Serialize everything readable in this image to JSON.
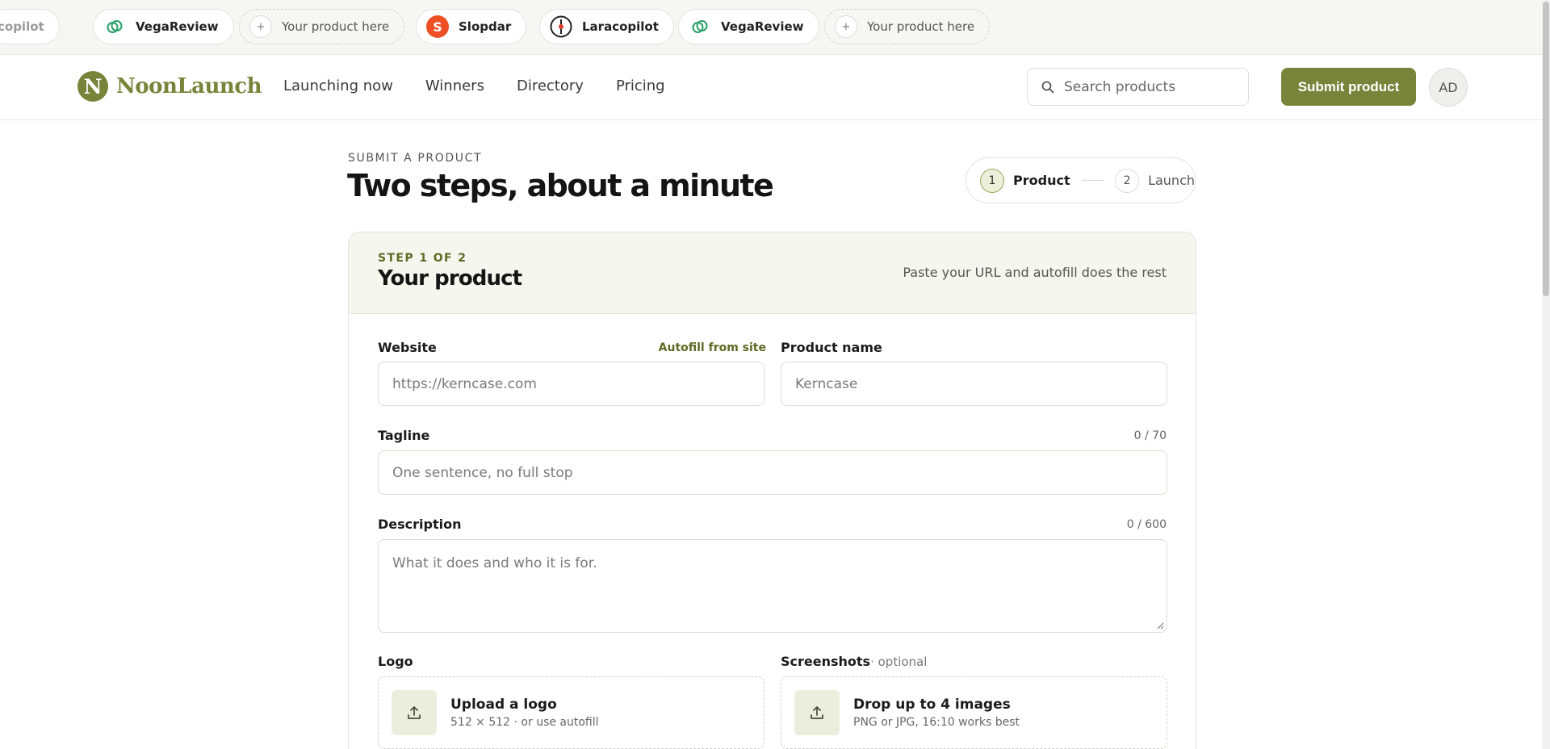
{
  "ticker": {
    "items": [
      {
        "label": "copilot",
        "icon": "laracopilot-icon",
        "dashed": false
      },
      {
        "label": "VegaReview",
        "icon": "vegareview-icon",
        "dashed": false
      },
      {
        "label": "Your product here",
        "icon": "plus-icon",
        "dashed": true
      },
      {
        "label": "Slopdar",
        "icon": "slopdar-icon",
        "dashed": false,
        "glyph": "S"
      },
      {
        "label": "Laracopilot",
        "icon": "laracopilot-icon",
        "dashed": false
      },
      {
        "label": "VegaReview",
        "icon": "vegareview-icon",
        "dashed": false
      },
      {
        "label": "Your product here",
        "icon": "plus-icon",
        "dashed": true
      }
    ],
    "plus_glyph": "+"
  },
  "header": {
    "logo_mark": "N",
    "logo_text": "NoonLaunch",
    "nav": [
      "Launching now",
      "Winners",
      "Directory",
      "Pricing"
    ],
    "search_placeholder": "Search products",
    "submit_label": "Submit product",
    "avatar_initials": "AD"
  },
  "page": {
    "eyebrow": "SUBMIT A PRODUCT",
    "title": "Two steps, about a minute",
    "steps": [
      {
        "number": "1",
        "label": "Product",
        "active": true
      },
      {
        "number": "2",
        "label": "Launch",
        "active": false
      }
    ]
  },
  "card": {
    "step_label": "STEP 1 OF 2",
    "title": "Your product",
    "hint": "Paste your URL and autofill does the rest",
    "website": {
      "label": "Website",
      "action": "Autofill from site",
      "placeholder": "https://kerncase.com"
    },
    "product_name": {
      "label": "Product name",
      "placeholder": "Kerncase"
    },
    "tagline": {
      "label": "Tagline",
      "counter": "0 / 70",
      "placeholder": "One sentence, no full stop"
    },
    "description": {
      "label": "Description",
      "counter": "0 / 600",
      "placeholder": "What it does and who it is for."
    },
    "logo": {
      "label": "Logo",
      "title": "Upload a logo",
      "sub": "512 × 512 · or use autofill"
    },
    "screenshots": {
      "label": "Screenshots",
      "optional": "· optional",
      "title": "Drop up to 4 images",
      "sub": "PNG or JPG, 16:10 works best"
    }
  },
  "colors": {
    "accent": "#78843a",
    "accent_soft": "#f5f6ee",
    "slopdar": "#ef4f24"
  }
}
